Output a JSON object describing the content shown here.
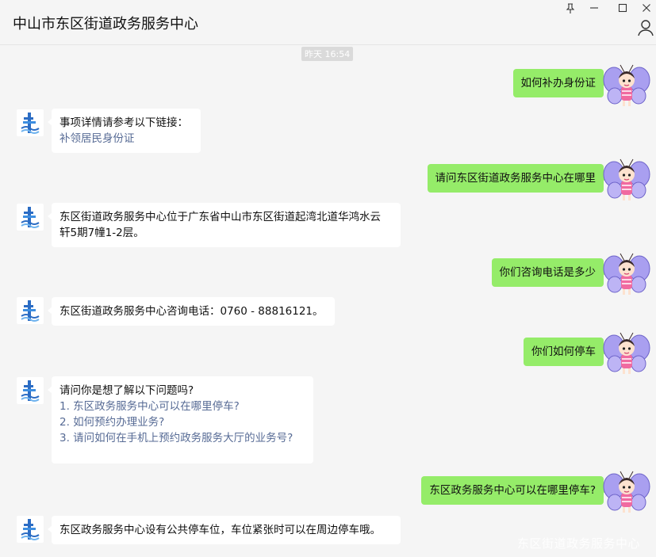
{
  "window": {
    "title": "中山市东区街道政务服务中心",
    "controls": [
      "pin-icon",
      "minimize-icon",
      "maximize-icon",
      "close-icon"
    ],
    "profile_icon": "person-icon"
  },
  "chat": {
    "timestamp": "昨天 16:54",
    "messages": [
      {
        "from": "user",
        "text": "如何补办身份证"
      },
      {
        "from": "bot",
        "line1": "事项详情请参考以下链接：",
        "link": "补领居民身份证"
      },
      {
        "from": "user",
        "text": "请问东区街道政务服务中心在哪里"
      },
      {
        "from": "bot",
        "line1": "东区街道政务服务中心位于广东省中山市东区街道起湾北道华鸿水云",
        "line2": "轩5期7幢1-2层。"
      },
      {
        "from": "user",
        "text": "你们咨询电话是多少"
      },
      {
        "from": "bot",
        "line1": "东区街道政务服务中心咨询电话：0760 - 88816121。"
      },
      {
        "from": "user",
        "text": "你们如何停车"
      },
      {
        "from": "bot",
        "line1": "请问你是想了解以下问题吗?",
        "options": [
          "1. 东区政务服务中心可以在哪里停车?",
          "2. 如何预约办理业务?",
          "3. 请问如何在手机上预约政务服务大厅的业务号?"
        ]
      },
      {
        "from": "user",
        "text": "东区政务服务中心可以在哪里停车?"
      },
      {
        "from": "bot",
        "line1": "东区政务服务中心设有公共停车位，车位紧张时可以在周边停车哦。"
      }
    ]
  },
  "watermark": "东区街道政务服务中心",
  "colors": {
    "background": "#f5f5f5",
    "user_bubble": "#95ec69",
    "bot_bubble": "#ffffff",
    "link": "#576b95"
  }
}
